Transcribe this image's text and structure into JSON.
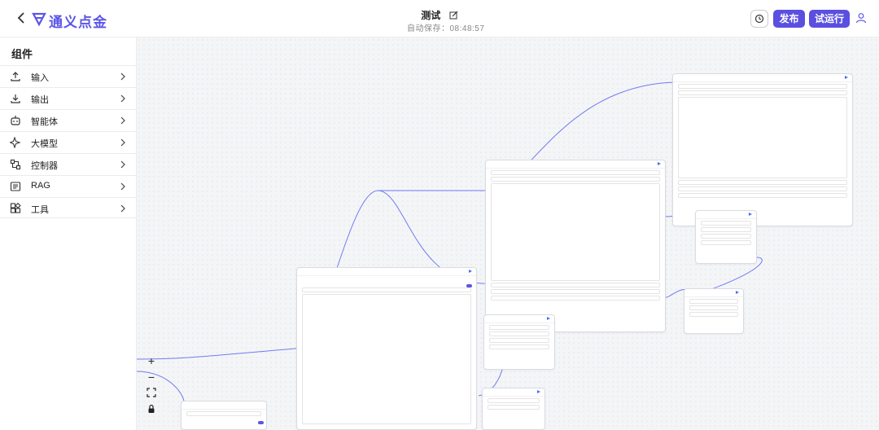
{
  "header": {
    "brand": "通义点金",
    "title": "测试",
    "autosave": "自动保存：08:48:57",
    "publish_label": "发布",
    "run_label": "试运行"
  },
  "sidebar": {
    "title": "组件",
    "items": [
      {
        "label": "输入",
        "icon": "upload-icon"
      },
      {
        "label": "输出",
        "icon": "download-icon"
      },
      {
        "label": "智能体",
        "icon": "robot-icon"
      },
      {
        "label": "大模型",
        "icon": "sparkle-icon"
      },
      {
        "label": "控制器",
        "icon": "controller-icon"
      },
      {
        "label": "RAG",
        "icon": "rag-icon"
      },
      {
        "label": "工具",
        "icon": "tools-icon"
      }
    ]
  },
  "colors": {
    "brand": "#5b55e8",
    "primary_button": "#5b4fe0",
    "edge": "#6f7cf0"
  }
}
